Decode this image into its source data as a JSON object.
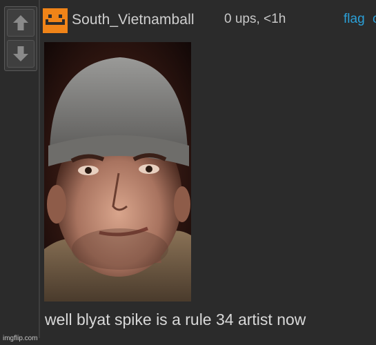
{
  "comment": {
    "username": "South_Vietnamball",
    "meta": "0 ups, <1h",
    "flag_label": "flag",
    "second_link": "c",
    "text": "well blyat spike is a rule 34 artist now"
  },
  "image": {
    "description": "soldier-portrait"
  },
  "footer": {
    "watermark": "imgflip.com"
  },
  "colors": {
    "background": "#2b2b2b",
    "avatar": "#f08418",
    "link": "#2ba0d8"
  },
  "icons": {
    "upvote": "arrow-up-icon",
    "downvote": "arrow-down-icon",
    "avatar": "robot-face-icon"
  }
}
